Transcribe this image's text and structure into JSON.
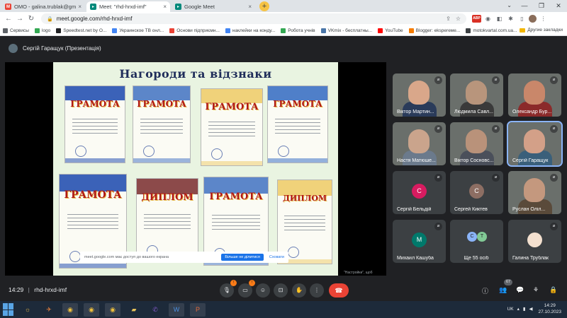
{
  "browser": {
    "tabs": [
      {
        "title": "ОМО - galina.trublak@gmail.co",
        "icon": "gmail-icon",
        "active": false
      },
      {
        "title": "Meet: \"rhd-hrxd-imf\"",
        "icon": "meet-icon",
        "active": true
      },
      {
        "title": "Google Meet",
        "icon": "meet-icon",
        "active": false
      }
    ],
    "new_tab": "+",
    "url": "meet.google.com/rhd-hrxd-imf",
    "bookmarks": [
      {
        "label": "Сервисы",
        "color": "#5f6368"
      },
      {
        "label": "logo",
        "color": "#34a853"
      },
      {
        "label": "Speedtest.net by O...",
        "color": "#202124"
      },
      {
        "label": "Украинское ТВ онл...",
        "color": "#4285f4"
      },
      {
        "label": "Основи підприємн...",
        "color": "#ea4335"
      },
      {
        "label": "наклейки на конду...",
        "color": "#4285f4"
      },
      {
        "label": "Робота учнів",
        "color": "#34a853"
      },
      {
        "label": "VKmix - бесплатны...",
        "color": "#4a76a8"
      },
      {
        "label": "YouTube",
        "color": "#ff0000"
      },
      {
        "label": "Blogger: eksperеме...",
        "color": "#f57c00"
      },
      {
        "label": "motokvartal.com.ua...",
        "color": "#3c4043"
      }
    ],
    "other_bookmarks": "Другие закладки"
  },
  "meet": {
    "presenter": "Сергій Гаращук (Презентація)",
    "slide": {
      "title": "Нагороди та відзнаки",
      "docs": [
        "ГРАМОТА",
        "ГРАМОТА",
        "ГРАМОТА",
        "ГРАМОТА",
        "ГРАМОТА",
        "ДИПЛОМ",
        "ГРАМОТА",
        "ДИПЛОМ"
      ]
    },
    "toast": {
      "message": "meet.google.com має доступ до вашого екрана",
      "button": "Більше не ділитися",
      "link": "Сховати"
    },
    "overlay_hint": "\"Настройки\", щоб",
    "participants": [
      {
        "name": "Віктор Мартин...",
        "type": "video",
        "face": "#d9a78a",
        "shirt": "#2a3b5a"
      },
      {
        "name": "Людмила Савл...",
        "type": "video",
        "face": "#b8957c",
        "shirt": "#3a3a3a"
      },
      {
        "name": "Олександр Бур...",
        "type": "video",
        "face": "#c9876a",
        "shirt": "#8b2a2a"
      },
      {
        "name": "Настя Матюше...",
        "type": "video",
        "face": "#caa48c",
        "shirt": "#6b7a8c"
      },
      {
        "name": "Віктор Сосновс...",
        "type": "video",
        "face": "#b9927a",
        "shirt": "#4a4f5a"
      },
      {
        "name": "Сергій Гаращук",
        "type": "video",
        "face": "#d3a088",
        "shirt": "#3a5f7a",
        "active": true
      },
      {
        "name": "Сергій Бельдій",
        "type": "avatar",
        "initial": "С",
        "color": "#d81b60"
      },
      {
        "name": "Сергей Киктев",
        "type": "avatar",
        "initial": "С",
        "color": "#8d6e63"
      },
      {
        "name": "Руслан Оліл...",
        "type": "video",
        "face": "#c4987e",
        "shirt": "#5a4a3a"
      },
      {
        "name": "Михаил Кашуба",
        "type": "avatar",
        "initial": "М",
        "color": "#00796b"
      },
      {
        "name": "Ще 55 осіб",
        "type": "more",
        "initials": [
          "С",
          "Т"
        ]
      },
      {
        "name": "Галина Трублак",
        "type": "avatar",
        "initial": "",
        "color": "#f3e0cf"
      }
    ],
    "bottom": {
      "time": "14:29",
      "code": "rhd-hrxd-imf",
      "mic_badge": "!",
      "cam_badge": "!",
      "people_count": "67"
    }
  },
  "taskbar": {
    "lang": "UK",
    "time": "14:29",
    "date": "27.10.2023"
  }
}
